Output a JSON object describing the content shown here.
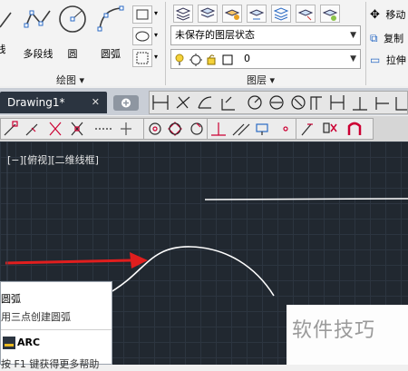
{
  "ribbon": {
    "draw_tools": [
      {
        "label": "线",
        "icon": "line-icon"
      },
      {
        "label": "多段线",
        "icon": "polyline-icon"
      },
      {
        "label": "圆",
        "icon": "circle-icon"
      },
      {
        "label": "圆弧",
        "icon": "arc-icon"
      }
    ],
    "draw_panel_title": "绘图 ▾",
    "layer_state_value": "未保存的图层状态",
    "layer_current_value": "0",
    "layers_panel_title": "图层 ▾",
    "modify_items": [
      "移动",
      "复制",
      "拉伸"
    ]
  },
  "tabs": {
    "active_label": "Drawing1*",
    "close_glyph": "✕"
  },
  "viewport": {
    "label": "[−][俯视][二维线框]"
  },
  "tooltip": {
    "title": "圆弧",
    "description": "用三点创建圆弧",
    "command": "ARC",
    "help_text": "按 F1 键获得更多帮助"
  },
  "watermark": {
    "text": "软件技巧"
  },
  "colors": {
    "canvas_bg": "#212830",
    "arrow": "#e01e1e",
    "geometry": "#ffffff"
  }
}
